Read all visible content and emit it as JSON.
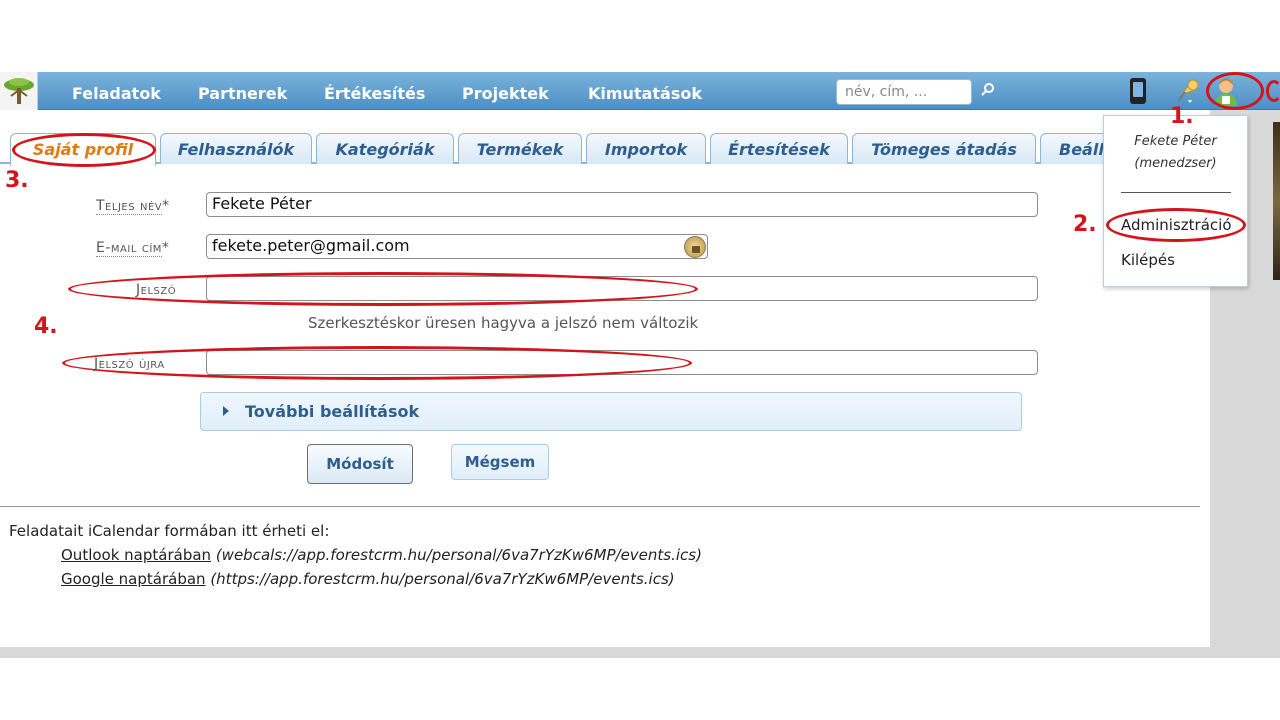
{
  "nav": {
    "items": [
      "Feladatok",
      "Partnerek",
      "Értékesítés",
      "Projektek",
      "Kimutatások"
    ],
    "search_placeholder": "név, cím, ..."
  },
  "tabs": [
    "Saját profil",
    "Felhasználók",
    "Kategóriák",
    "Termékek",
    "Importok",
    "Értesítések",
    "Tömeges átadás",
    "Beáll"
  ],
  "form": {
    "fullname_label": "Teljes név",
    "fullname_value": "Fekete Péter",
    "email_label": "E-mail cím",
    "email_value": "fekete.peter@gmail.com",
    "password_label": "Jelszó",
    "password_hint": "Szerkesztéskor üresen hagyva a jelszó nem változik",
    "password_again_label": "Jelszó újra",
    "required_mark": "*",
    "advanced_label": "További beállítások",
    "save_label": "Módosít",
    "cancel_label": "Mégsem"
  },
  "calendar": {
    "intro": "Feladatait iCalendar formában itt érheti el:",
    "outlook_link": "Outlook naptárában",
    "outlook_url": "(webcals://app.forestcrm.hu/personal/6va7rYzKw6MP/events.ics)",
    "google_link": "Google naptárában",
    "google_url": "(https://app.forestcrm.hu/personal/6va7rYzKw6MP/events.ics)"
  },
  "user_menu": {
    "name": "Fekete Péter",
    "role": "(menedzser)",
    "admin_label": "Adminisztráció",
    "logout_label": "Kilépés"
  },
  "annotations": [
    "1.",
    "2.",
    "3.",
    "4."
  ],
  "colors": {
    "nav_bar": "#5f9ccd",
    "active_tab_text": "#e07a12",
    "tab_text": "#2d5e8e",
    "annotation_red": "#d4141c"
  },
  "icons": [
    "tree-logo-icon",
    "search-icon",
    "phone-icon",
    "pin-icon",
    "user-icon",
    "refresh-icon",
    "lock-icon",
    "triangle-right-icon"
  ]
}
